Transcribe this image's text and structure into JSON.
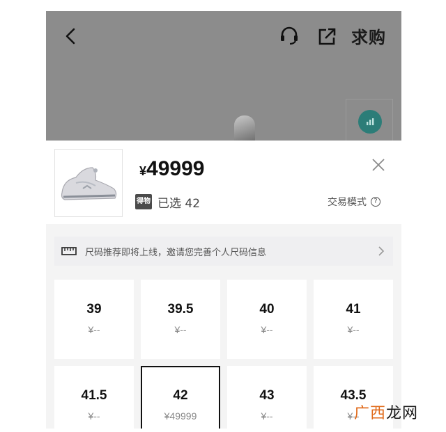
{
  "header": {
    "want_label": "求购"
  },
  "product": {
    "currency": "¥",
    "price": "49999",
    "selected_badge": "得物",
    "selected_text": "已选 42",
    "trade_mode_label": "交易模式",
    "trade_mode_help": "?"
  },
  "size_tip": {
    "text": "尺码推荐即将上线，邀请您完善个人尺码信息"
  },
  "sizes": [
    {
      "size": "39",
      "price": "¥--"
    },
    {
      "size": "39.5",
      "price": "¥--"
    },
    {
      "size": "40",
      "price": "¥--"
    },
    {
      "size": "41",
      "price": "¥--"
    },
    {
      "size": "41.5",
      "price": "¥--"
    },
    {
      "size": "42",
      "price": "¥49999"
    },
    {
      "size": "43",
      "price": "¥--"
    },
    {
      "size": "43.5",
      "price": "¥--"
    }
  ],
  "selected_size": "42",
  "watermark": {
    "accent": "广西",
    "rest": "龙网"
  },
  "colors": {
    "overlay": "#8c8c8c",
    "chart_button": "#2c7d78",
    "watermark_accent": "#e06a1a"
  }
}
